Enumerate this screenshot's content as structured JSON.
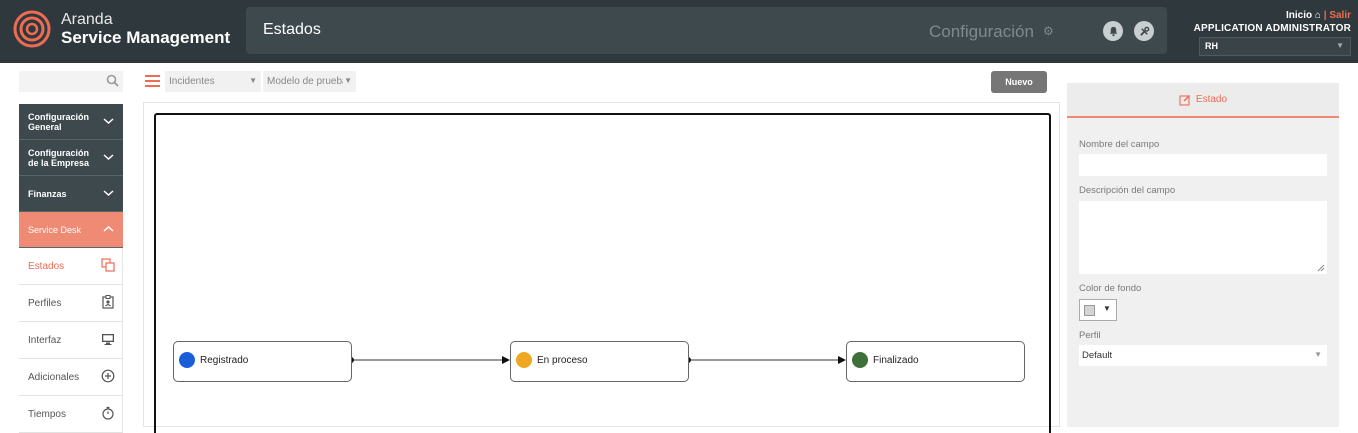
{
  "header": {
    "brand_top": "Aranda",
    "brand_bottom": "Service Management",
    "page_title": "Estados",
    "config_label": "Configuración",
    "home_label": "Inicio",
    "separator": "|",
    "logout_label": "Salir",
    "user_name": "APPLICATION ADMINISTRATOR",
    "project_selected": "RH"
  },
  "sidebar": {
    "search_placeholder": "",
    "groups": [
      {
        "label": "Configuración General"
      },
      {
        "label": "Configuración de la Empresa"
      },
      {
        "label": "Finanzas"
      },
      {
        "label": "Service Desk"
      }
    ],
    "items": [
      {
        "label": "Estados",
        "icon": "copy-icon"
      },
      {
        "label": "Perfiles",
        "icon": "id-badge-icon"
      },
      {
        "label": "Interfaz",
        "icon": "monitor-icon"
      },
      {
        "label": "Adicionales",
        "icon": "plus-circle-icon"
      },
      {
        "label": "Tiempos",
        "icon": "stopwatch-icon"
      }
    ]
  },
  "toolbar": {
    "case_type_selected": "Incidentes",
    "model_selected": "Modelo de prueba",
    "new_button": "Nuevo"
  },
  "workflow": {
    "states": [
      {
        "label": "Registrado",
        "color": "#1a5fd8"
      },
      {
        "label": "En proceso",
        "color": "#f0a823"
      },
      {
        "label": "Finalizado",
        "color": "#3f6f3a"
      }
    ]
  },
  "panel": {
    "tab_label": "Estado",
    "field_name_label": "Nombre del campo",
    "field_name_value": "",
    "field_desc_label": "Descripción del campo",
    "field_desc_value": "",
    "bg_color_label": "Color de fondo",
    "profile_label": "Perfil",
    "profile_selected": "Default"
  },
  "colors": {
    "accent": "#ee6c52",
    "header_bg": "#2f383c",
    "nav_bg": "#3e494e"
  }
}
